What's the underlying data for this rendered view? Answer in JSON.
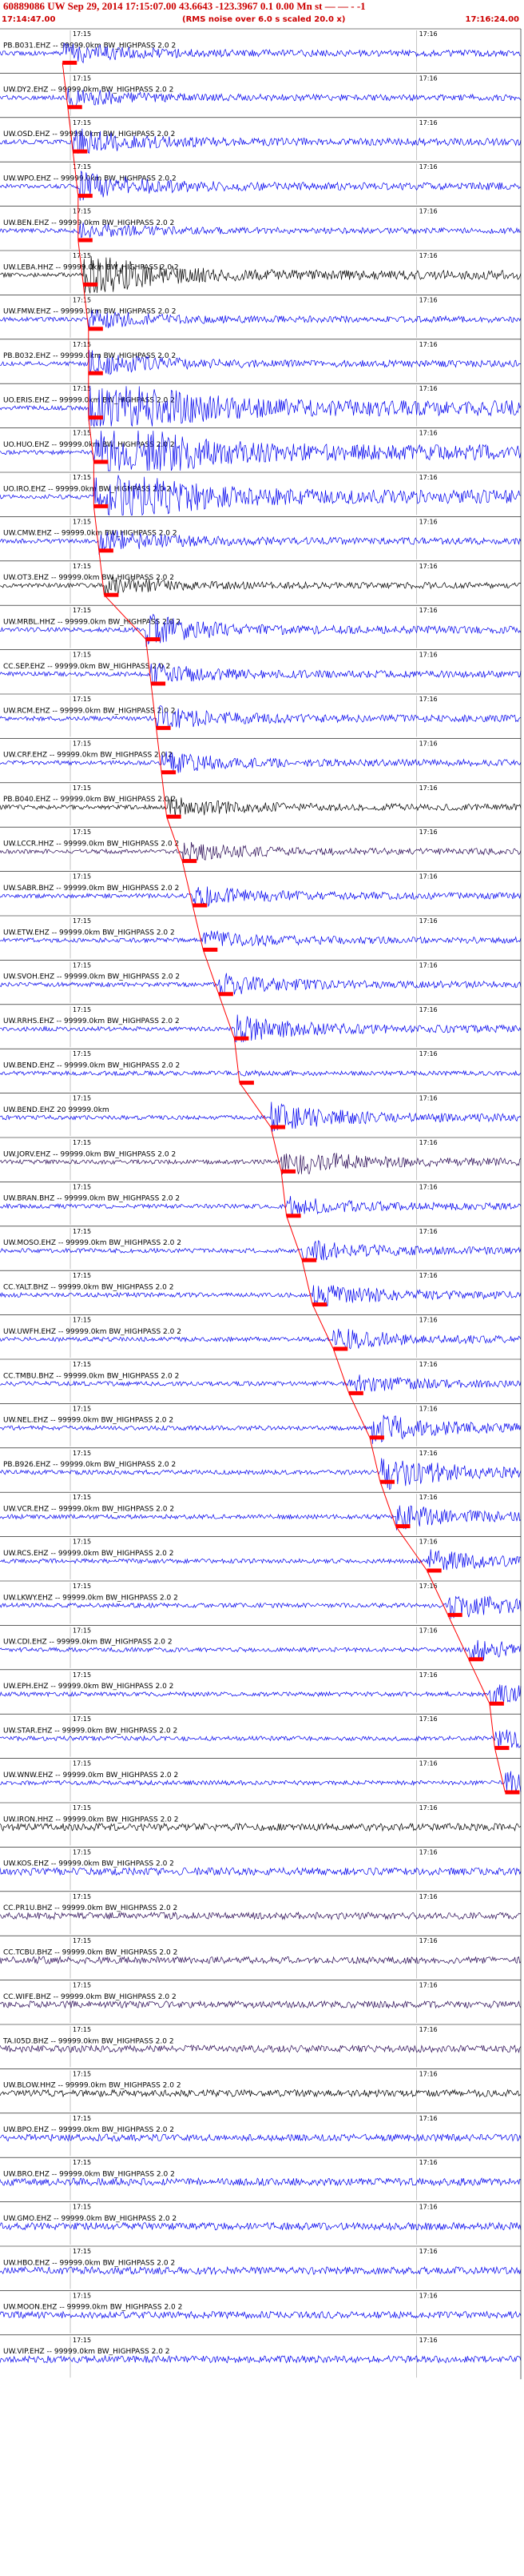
{
  "header": {
    "title": "60889086 UW Sep 29, 2014 17:15:07.00   43.6643 -123.3967  0.1 0.00 Mn st — — - -1",
    "start_time": "17:14:47.00",
    "end_time": "17:16:24.00",
    "noise_note": "(RMS noise over 6.0 s scaled 20.0 x)"
  },
  "colors": {
    "trace": "#0000ee",
    "dark_trace": "#000000",
    "purple_trace": "#2a0a55",
    "pick": "#ff0000",
    "grid": "#888888",
    "label": "#000000"
  },
  "chart_data": {
    "type": "line",
    "title": "60889086 UW Sep 29, 2014 17:15:07.00   43.6643 -123.3967  0.1 0.00 Mn st — — - -1",
    "x_range": [
      "17:14:47.00",
      "17:16:24.00"
    ],
    "tick_labels": [
      "17:15",
      "17:16"
    ],
    "series": [
      {
        "name": "PB.B031.EHZ -- 99999.0km BW_HIGHPASS 2.0 2",
        "pick": 0.12,
        "amp": 0.35,
        "color": "blue"
      },
      {
        "name": "UW.DY2.EHZ -- 99999.0km BW_HIGHPASS 2.0 2",
        "pick": 0.13,
        "amp": 0.3,
        "color": "blue"
      },
      {
        "name": "UW.OSD.EHZ -- 99999.0km BW_HIGHPASS 2.0 2",
        "pick": 0.14,
        "amp": 0.45,
        "color": "blue"
      },
      {
        "name": "UW.WPO.EHZ -- 99999.0km BW_HIGHPASS 2.0 2",
        "pick": 0.15,
        "amp": 0.5,
        "color": "blue"
      },
      {
        "name": "UW.BEN.EHZ -- 99999.0km BW_HIGHPASS 2.0 2",
        "pick": 0.15,
        "amp": 0.25,
        "color": "blue"
      },
      {
        "name": "UW.LEBA.HHZ -- 99999.0km BW_HIGHPASS 2.0 2",
        "pick": 0.16,
        "amp": 0.8,
        "color": "black"
      },
      {
        "name": "UW.FMW.EHZ -- 99999.0km BW_HIGHPASS 2.0 2",
        "pick": 0.17,
        "amp": 0.3,
        "color": "blue"
      },
      {
        "name": "PB.B032.EHZ -- 99999.0km BW_HIGHPASS 2.0 2",
        "pick": 0.17,
        "amp": 0.4,
        "color": "blue"
      },
      {
        "name": "UO.ERIS.EHZ -- 99999.0km BW_HIGHPASS 2.0 2",
        "pick": 0.17,
        "amp": 1.8,
        "color": "blue"
      },
      {
        "name": "UO.HUO.EHZ -- 99999.0km BW_HIGHPASS 2.0 2",
        "pick": 0.18,
        "amp": 1.8,
        "color": "blue"
      },
      {
        "name": "UO.IRO.EHZ -- 99999.0km BW_HIGHPASS 2.0 2",
        "pick": 0.18,
        "amp": 1.5,
        "color": "blue"
      },
      {
        "name": "UW.CMW.EHZ -- 99999.0km BW_HIGHPASS 2.0 2",
        "pick": 0.19,
        "amp": 0.4,
        "color": "blue"
      },
      {
        "name": "UW.OT3.EHZ -- 99999.0km BW_HIGHPASS 2.0 2",
        "pick": 0.2,
        "amp": 0.3,
        "color": "black"
      },
      {
        "name": "UW.MRBL.HHZ -- 99999.0km BW_HIGHPASS 2.0 2",
        "pick": 0.28,
        "amp": 0.5,
        "color": "blue"
      },
      {
        "name": "CC.SEP.EHZ -- 99999.0km BW_HIGHPASS 2.0 2",
        "pick": 0.29,
        "amp": 0.35,
        "color": "blue"
      },
      {
        "name": "UW.RCM.EHZ -- 99999.0km BW_HIGHPASS 2.0 2",
        "pick": 0.3,
        "amp": 0.4,
        "color": "blue"
      },
      {
        "name": "UW.CRF.EHZ -- 99999.0km BW_HIGHPASS 2.0 2",
        "pick": 0.31,
        "amp": 0.35,
        "color": "blue"
      },
      {
        "name": "PB.B040.EHZ -- 99999.0km BW_HIGHPASS 2.0 2",
        "pick": 0.32,
        "amp": 0.35,
        "color": "black"
      },
      {
        "name": "UW.LCCR.HHZ -- 99999.0km BW_HIGHPASS 2.0 2",
        "pick": 0.35,
        "amp": 0.3,
        "color": "purple"
      },
      {
        "name": "UW.SABR.BHZ -- 99999.0km BW_HIGHPASS 2.0 2",
        "pick": 0.37,
        "amp": 0.35,
        "color": "blue"
      },
      {
        "name": "UW.ETW.EHZ -- 99999.0km BW_HIGHPASS 2.0 2",
        "pick": 0.39,
        "amp": 0.3,
        "color": "blue"
      },
      {
        "name": "UW.SVOH.EHZ -- 99999.0km BW_HIGHPASS 2.0 2",
        "pick": 0.42,
        "amp": 0.35,
        "color": "blue"
      },
      {
        "name": "UW.RRHS.EHZ -- 99999.0km BW_HIGHPASS 2.0 2",
        "pick": 0.45,
        "amp": 0.45,
        "color": "blue"
      },
      {
        "name": "UW.BEND.EHZ -- 99999.0km BW_HIGHPASS 2.0 2",
        "pick": 0.46,
        "amp": 0.02,
        "color": "blue"
      },
      {
        "name": "UW.BEND.EHZ 20 99999.0km",
        "pick": 0.52,
        "amp": 0.5,
        "color": "blue"
      },
      {
        "name": "UW.JORV.EHZ -- 99999.0km BW_HIGHPASS 2.0 2",
        "pick": 0.54,
        "amp": 0.5,
        "color": "purple"
      },
      {
        "name": "UW.BRAN.BHZ -- 99999.0km BW_HIGHPASS 2.0 2",
        "pick": 0.55,
        "amp": 0.3,
        "color": "blue"
      },
      {
        "name": "UW.MOSO.EHZ -- 99999.0km BW_HIGHPASS 2.0 2",
        "pick": 0.58,
        "amp": 0.35,
        "color": "blue"
      },
      {
        "name": "CC.YALT.BHZ -- 99999.0km BW_HIGHPASS 2.0 2",
        "pick": 0.6,
        "amp": 0.4,
        "color": "blue"
      },
      {
        "name": "UW.UWFH.EHZ -- 99999.0km BW_HIGHPASS 2.0 2",
        "pick": 0.64,
        "amp": 0.35,
        "color": "blue"
      },
      {
        "name": "CC.TMBU.BHZ -- 99999.0km BW_HIGHPASS 2.0 2",
        "pick": 0.67,
        "amp": 0.3,
        "color": "blue"
      },
      {
        "name": "UW.NEL.EHZ -- 99999.0km BW_HIGHPASS 2.0 2",
        "pick": 0.71,
        "amp": 0.5,
        "color": "blue"
      },
      {
        "name": "PB.B926.EHZ -- 99999.0km BW_HIGHPASS 2.0 2",
        "pick": 0.73,
        "amp": 0.6,
        "color": "blue"
      },
      {
        "name": "UW.VCR.EHZ -- 99999.0km BW_HIGHPASS 2.0 2",
        "pick": 0.76,
        "amp": 0.4,
        "color": "blue"
      },
      {
        "name": "UW.RCS.EHZ -- 99999.0km BW_HIGHPASS 2.0 2",
        "pick": 0.82,
        "amp": 0.35,
        "color": "blue"
      },
      {
        "name": "UW.LKWY.EHZ -- 99999.0km BW_HIGHPASS 2.0 2",
        "pick": 0.86,
        "amp": 0.45,
        "color": "blue"
      },
      {
        "name": "UW.CDI.EHZ -- 99999.0km BW_HIGHPASS 2.0 2",
        "pick": 0.9,
        "amp": 0.35,
        "color": "blue"
      },
      {
        "name": "UW.EPH.EHZ -- 99999.0km BW_HIGHPASS 2.0 2",
        "pick": 0.94,
        "amp": 0.35,
        "color": "blue"
      },
      {
        "name": "UW.STAR.EHZ -- 99999.0km BW_HIGHPASS 2.0 2",
        "pick": 0.95,
        "amp": 0.35,
        "color": "blue"
      },
      {
        "name": "UW.WNW.EHZ -- 99999.0km BW_HIGHPASS 2.0 2",
        "pick": 0.97,
        "amp": 0.35,
        "color": "blue"
      },
      {
        "name": "UW.IRON.HHZ -- 99999.0km BW_HIGHPASS 2.0 2",
        "pick": null,
        "amp": 0.35,
        "color": "black"
      },
      {
        "name": "UW.KOS.EHZ -- 99999.0km BW_HIGHPASS 2.0 2",
        "pick": null,
        "amp": 0.35,
        "color": "blue"
      },
      {
        "name": "CC.PR1U.BHZ -- 99999.0km BW_HIGHPASS 2.0 2",
        "pick": null,
        "amp": 0.3,
        "color": "purple"
      },
      {
        "name": "CC.TCBU.BHZ -- 99999.0km BW_HIGHPASS 2.0 2",
        "pick": null,
        "amp": 0.3,
        "color": "purple"
      },
      {
        "name": "CC.WIFE.BHZ -- 99999.0km BW_HIGHPASS 2.0 2",
        "pick": null,
        "amp": 0.3,
        "color": "purple"
      },
      {
        "name": "TA.I05D.BHZ -- 99999.0km BW_HIGHPASS 2.0 2",
        "pick": null,
        "amp": 0.3,
        "color": "purple"
      },
      {
        "name": "UW.BLOW.HHZ -- 99999.0km BW_HIGHPASS 2.0 2",
        "pick": null,
        "amp": 0.3,
        "color": "black"
      },
      {
        "name": "UW.BPO.EHZ -- 99999.0km BW_HIGHPASS 2.0 2",
        "pick": null,
        "amp": 0.3,
        "color": "blue"
      },
      {
        "name": "UW.BRO.EHZ -- 99999.0km BW_HIGHPASS 2.0 2",
        "pick": null,
        "amp": 0.35,
        "color": "blue"
      },
      {
        "name": "UW.GMO.EHZ -- 99999.0km BW_HIGHPASS 2.0 2",
        "pick": null,
        "amp": 0.35,
        "color": "blue"
      },
      {
        "name": "UW.HBO.EHZ -- 99999.0km BW_HIGHPASS 2.0 2",
        "pick": null,
        "amp": 0.35,
        "color": "blue"
      },
      {
        "name": "UW.MOON.EHZ -- 99999.0km BW_HIGHPASS 2.0 2",
        "pick": null,
        "amp": 0.3,
        "color": "blue"
      },
      {
        "name": "UW.VIP.EHZ -- 99999.0km BW_HIGHPASS 2.0 2",
        "pick": null,
        "amp": 0.3,
        "color": "blue"
      }
    ]
  }
}
